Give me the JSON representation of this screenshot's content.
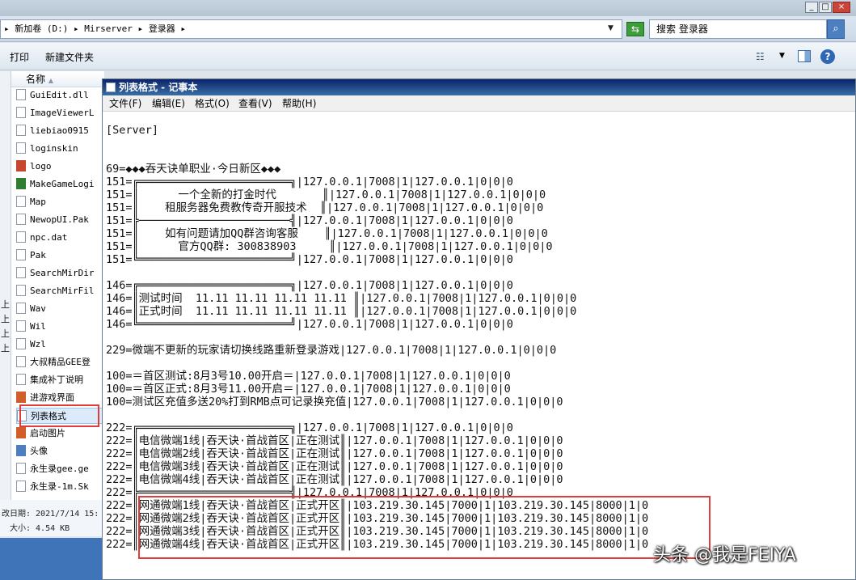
{
  "explorer": {
    "address": "▸ 新加卷 (D:) ▸ Mirserver ▸ 登录器 ▸",
    "search_placeholder": "搜索 登录器",
    "toolbar": [
      "打印",
      "新建文件夹"
    ],
    "column_name": "名称",
    "files": [
      "GuiEdit.dll",
      "ImageViewerL",
      "liebiao0915",
      "loginskin",
      "logo",
      "MakeGameLogi",
      "Map",
      "NewopUI.Pak",
      "npc.dat",
      "Pak",
      "SearchMirDir",
      "SearchMirFil",
      "Wav",
      "Wil",
      "Wzl",
      "大叔精品GEE登",
      "集成补丁说明",
      "进游戏界面",
      "列表格式",
      "启动图片",
      "头像",
      "永生录gee.ge",
      "永生录-1m.Sk"
    ],
    "selected_index": 18,
    "left_strip": [
      "上",
      "上",
      "上",
      "上"
    ],
    "details": {
      "modified": "改日期: 2021/7/14 15:",
      "size": "大小: 4.54 KB"
    }
  },
  "notepad": {
    "title": "列表格式 - 记事本",
    "menu": [
      "文件(F)",
      "编辑(E)",
      "格式(O)",
      "查看(V)",
      "帮助(H)"
    ],
    "lines": [
      "[Server]",
      "",
      "",
      "69=◆◆◆吞天诀单职业·今日新区◆◆◆",
      "151=╔═══════════════════════╗|127.0.0.1|7008|1|127.0.0.1|0|0|0",
      "151=║      一个全新的打金时代       ║|127.0.0.1|7008|1|127.0.0.1|0|0|0",
      "151=║    租服务器免费教传奇开服技术  ║|127.0.0.1|7008|1|127.0.0.1|0|0|0",
      "151=╠───────────────────────╣|127.0.0.1|7008|1|127.0.0.1|0|0|0",
      "151=║    如有问题请加QQ群咨询客服    ║|127.0.0.1|7008|1|127.0.0.1|0|0|0",
      "151=║      官方QQ群: 300838903     ║|127.0.0.1|7008|1|127.0.0.1|0|0|0",
      "151=╚═══════════════════════╝|127.0.0.1|7008|1|127.0.0.1|0|0|0",
      "",
      "146=╔═══════════════════════╗|127.0.0.1|7008|1|127.0.0.1|0|0|0",
      "146=║测试时间  11.11 11.11 11.11 11.11 ║|127.0.0.1|7008|1|127.0.0.1|0|0|0",
      "146=║正式时间  11.11 11.11 11.11 11.11 ║|127.0.0.1|7008|1|127.0.0.1|0|0|0",
      "146=╚═══════════════════════╝|127.0.0.1|7008|1|127.0.0.1|0|0|0",
      "",
      "229=微端不更新的玩家请切换线路重新登录游戏|127.0.0.1|7008|1|127.0.0.1|0|0|0",
      "",
      "100=＝首区测试:8月3号10.00开启＝|127.0.0.1|7008|1|127.0.0.1|0|0|0",
      "100=＝首区正式:8月3号11.00开启＝|127.0.0.1|7008|1|127.0.0.1|0|0|0",
      "100=测试区充值多送20%打到RMB点可记录换充值|127.0.0.1|7008|1|127.0.0.1|0|0|0",
      "",
      "222=╔═══════════════════════╗|127.0.0.1|7008|1|127.0.0.1|0|0|0",
      "222=║电信微端1线|吞天诀·首战首区|正在测试║|127.0.0.1|7008|1|127.0.0.1|0|0|0",
      "222=║电信微端2线|吞天诀·首战首区|正在测试║|127.0.0.1|7008|1|127.0.0.1|0|0|0",
      "222=║电信微端3线|吞天诀·首战首区|正在测试║|127.0.0.1|7008|1|127.0.0.1|0|0|0",
      "222=║电信微端4线|吞天诀·首战首区|正在测试║|127.0.0.1|7008|1|127.0.0.1|0|0|0",
      "222=╠═══════════════════════╣|127.0.0.1|7008|1|127.0.0.1|0|0|0",
      "222=║网通微端1线|吞天诀·首战首区|正式开区║|103.219.30.145|7000|1|103.219.30.145|8000|1|0",
      "222=║网通微端2线|吞天诀·首战首区|正式开区║|103.219.30.145|7000|1|103.219.30.145|8000|1|0",
      "222=║网通微端3线|吞天诀·首战首区|正式开区║|103.219.30.145|7000|1|103.219.30.145|8000|1|0",
      "222=║网通微端4线|吞天诀·首战首区|正式开区║|103.219.30.145|7000|1|103.219.30.145|8000|1|0"
    ]
  },
  "watermark": "头条 @我是FEIYA"
}
